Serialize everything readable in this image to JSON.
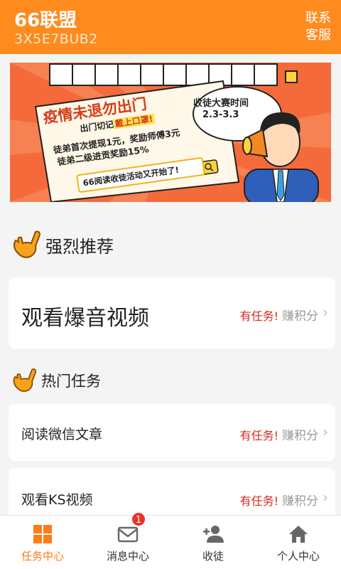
{
  "header": {
    "title": "66联盟",
    "code": "3X5E7BUB2",
    "contact_line1": "联系",
    "contact_line2": "客服"
  },
  "banner": {
    "title": "疫情未退勿出门",
    "sub_prefix": "出门切记",
    "sub_highlight": "戴上口罩!",
    "line2": "徒弟首次提现1元，奖励师傅3元",
    "line3": "徒弟二级进贡奖励15%",
    "pill": "66阅读收徒活动又开始了!",
    "bubble_line1": "收徒大赛时间",
    "bubble_line2": "2.3-3.3"
  },
  "sections": {
    "recommend_title": "强烈推荐",
    "hot_title": "热门任务"
  },
  "recommend": {
    "name": "观看爆音视频",
    "task": "有任务!",
    "earn": "赚积分"
  },
  "hot": [
    {
      "name": "阅读微信文章",
      "task": "有任务!",
      "earn": "赚积分"
    },
    {
      "name": "观看KS视频",
      "task": "有任务!",
      "earn": "赚积分"
    }
  ],
  "nav": [
    {
      "label": "任务中心",
      "icon": "grid-icon",
      "active": true
    },
    {
      "label": "消息中心",
      "icon": "mail-icon",
      "badge": "1"
    },
    {
      "label": "收徒",
      "icon": "add-user-icon"
    },
    {
      "label": "个人中心",
      "icon": "home-icon"
    }
  ],
  "colors": {
    "accent": "#ff8a1d",
    "task_red": "#d5281d",
    "badge_red": "#e9322a"
  }
}
